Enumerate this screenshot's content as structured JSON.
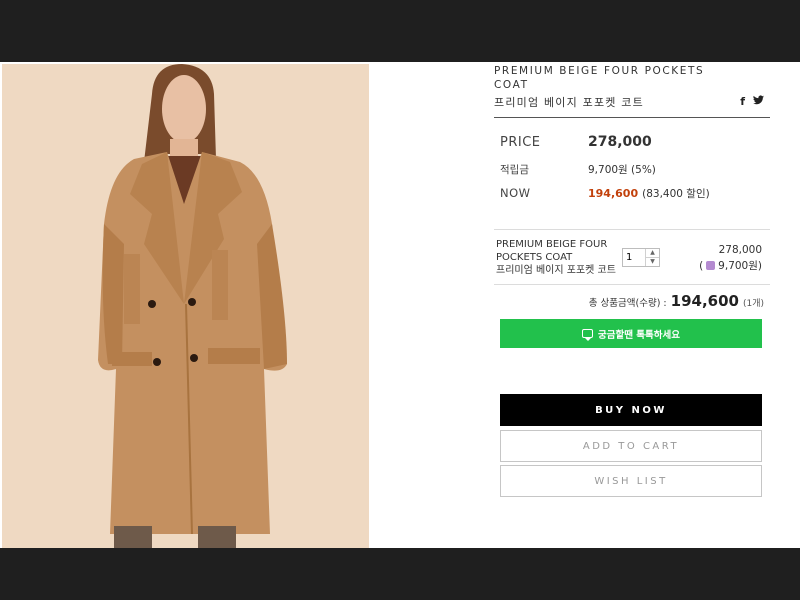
{
  "product": {
    "title_en": "PREMIUM BEIGE FOUR POCKETS COAT",
    "title_ko": "프리미엄 베이지 포포켓 코트",
    "image_alt": "Premium beige four pockets coat worn by a model"
  },
  "social": {
    "facebook": "f",
    "twitter": "🐦"
  },
  "pricing": {
    "price_label": "PRICE",
    "price_value": "278,000",
    "points_label": "적립금",
    "points_value": "9,700원 (5%)",
    "now_label": "NOW",
    "now_value": "194,600",
    "now_discount": "(83,400 할인)"
  },
  "option": {
    "name_en": "PREMIUM BEIGE FOUR POCKETS COAT",
    "name_ko": "프리미엄 베이지 포포켓 코트",
    "quantity": "1",
    "price": "278,000",
    "points": "9,700원)",
    "points_prefix": "("
  },
  "total": {
    "label": "총 상품금액(수량) :",
    "value": "194,600",
    "count": "(1개)"
  },
  "buttons": {
    "talk": "궁금할땐 톡톡하세요",
    "buy": "BUY NOW",
    "cart": "ADD TO CART",
    "wish": "WISH LIST"
  },
  "colors": {
    "accent_green": "#22c14c",
    "sale_orange": "#c2410c",
    "buy_black": "#000000"
  },
  "icons": [
    "facebook-icon",
    "twitter-icon",
    "talk-bubble-icon",
    "points-icon",
    "stepper-up-icon",
    "stepper-down-icon"
  ]
}
